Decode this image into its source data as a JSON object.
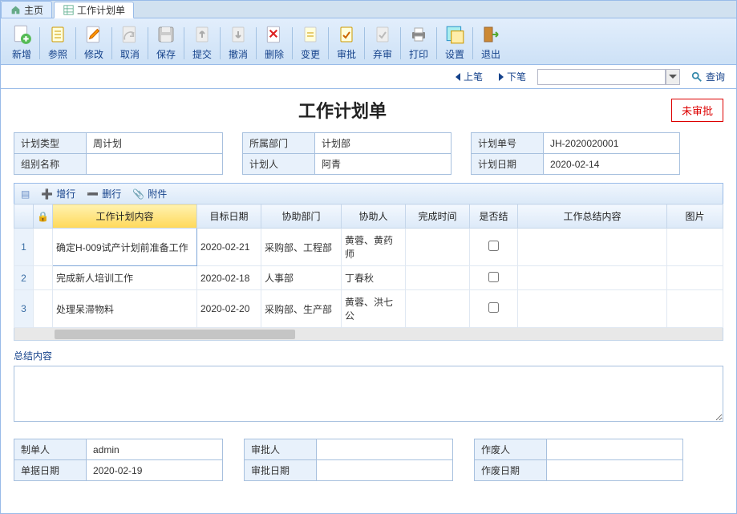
{
  "tabs": {
    "home": "主页",
    "doc": "工作计划单"
  },
  "toolbar": {
    "new": "新增",
    "ref": "参照",
    "edit": "修改",
    "cancel": "取消",
    "save": "保存",
    "submit": "提交",
    "undo": "撤消",
    "delete": "删除",
    "change": "变更",
    "approve": "审批",
    "reject": "弃审",
    "print": "打印",
    "setting": "设置",
    "exit": "退出"
  },
  "nav": {
    "prev": "上笔",
    "next": "下笔",
    "query": "查询"
  },
  "page": {
    "title": "工作计划单",
    "status": "未审批"
  },
  "headerFields": {
    "planType_l": "计划类型",
    "planType_v": "周计划",
    "groupName_l": "组别名称",
    "groupName_v": "",
    "dept_l": "所属部门",
    "dept_v": "计划部",
    "planner_l": "计划人",
    "planner_v": "阿青",
    "docNo_l": "计划单号",
    "docNo_v": "JH-2020020001",
    "planDate_l": "计划日期",
    "planDate_v": "2020-02-14"
  },
  "gridtb": {
    "addRow": "增行",
    "delRow": "删行",
    "attach": "附件"
  },
  "grid": {
    "cols": {
      "lock": "",
      "content": "工作计划内容",
      "targetDate": "目标日期",
      "assistDept": "协助部门",
      "assistant": "协助人",
      "doneTime": "完成时间",
      "done": "是否结",
      "summary": "工作总结内容",
      "image": "图片"
    },
    "rows": [
      {
        "n": "1",
        "content": "确定H-009试产计划前准备工作",
        "targetDate": "2020-02-21",
        "assistDept": "采购部、工程部",
        "assistant": "黄蓉、黄药师",
        "doneTime": "",
        "done": false,
        "summary": "",
        "image": ""
      },
      {
        "n": "2",
        "content": "完成新人培训工作",
        "targetDate": "2020-02-18",
        "assistDept": "人事部",
        "assistant": "丁春秋",
        "doneTime": "",
        "done": false,
        "summary": "",
        "image": ""
      },
      {
        "n": "3",
        "content": "处理呆滞物料",
        "targetDate": "2020-02-20",
        "assistDept": "采购部、生产部",
        "assistant": "黄蓉、洪七公",
        "doneTime": "",
        "done": false,
        "summary": "",
        "image": ""
      }
    ]
  },
  "summary": {
    "label": "总结内容",
    "value": ""
  },
  "footer": {
    "maker_l": "制单人",
    "maker_v": "admin",
    "docDate_l": "单据日期",
    "docDate_v": "2020-02-19",
    "approver_l": "审批人",
    "approver_v": "",
    "approveDate_l": "审批日期",
    "approveDate_v": "",
    "void_l": "作废人",
    "void_v": "",
    "voidDate_l": "作废日期",
    "voidDate_v": ""
  }
}
